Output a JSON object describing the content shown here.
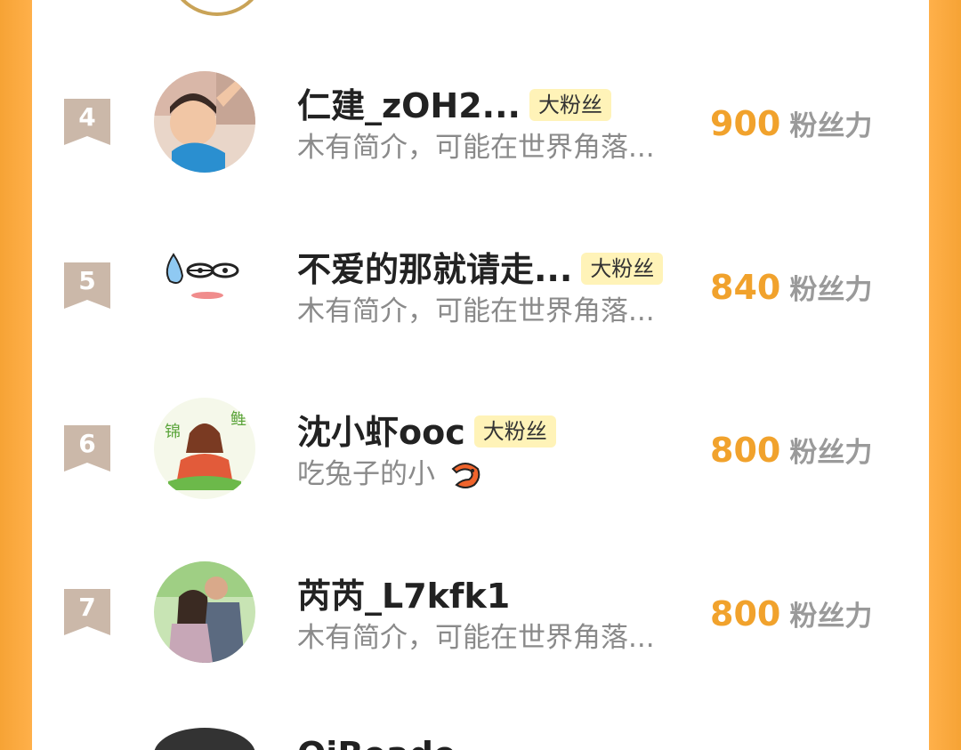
{
  "list": [
    {
      "rank": "4",
      "name": "仁建_zOH2...",
      "badge": "大粉丝",
      "bio": "木有简介，可能在世界角落...",
      "score": "900",
      "unit": "粉丝力",
      "avatar": "photo-girl"
    },
    {
      "rank": "5",
      "name": "不爱的那就请走...",
      "badge": "大粉丝",
      "bio": "木有简介，可能在世界角落...",
      "score": "840",
      "unit": "粉丝力",
      "avatar": "emoji-face"
    },
    {
      "rank": "6",
      "name": "沈小虾ooc",
      "badge": "大粉丝",
      "bio": "吃兔子的小",
      "bio_icon": "shrimp-emoji",
      "score": "800",
      "unit": "粉丝力",
      "avatar": "illustration-koi"
    },
    {
      "rank": "7",
      "name": "芮芮_L7kfk1",
      "badge": "",
      "bio": "木有简介，可能在世界角落...",
      "score": "800",
      "unit": "粉丝力",
      "avatar": "photo-couple"
    }
  ],
  "partial_next": {
    "name": "QiBeade"
  },
  "colors": {
    "accent": "#f1a22c",
    "frame": "#f6a335",
    "badge_bg": "#fff3b8",
    "rank_tag": "#cbb8a9"
  }
}
